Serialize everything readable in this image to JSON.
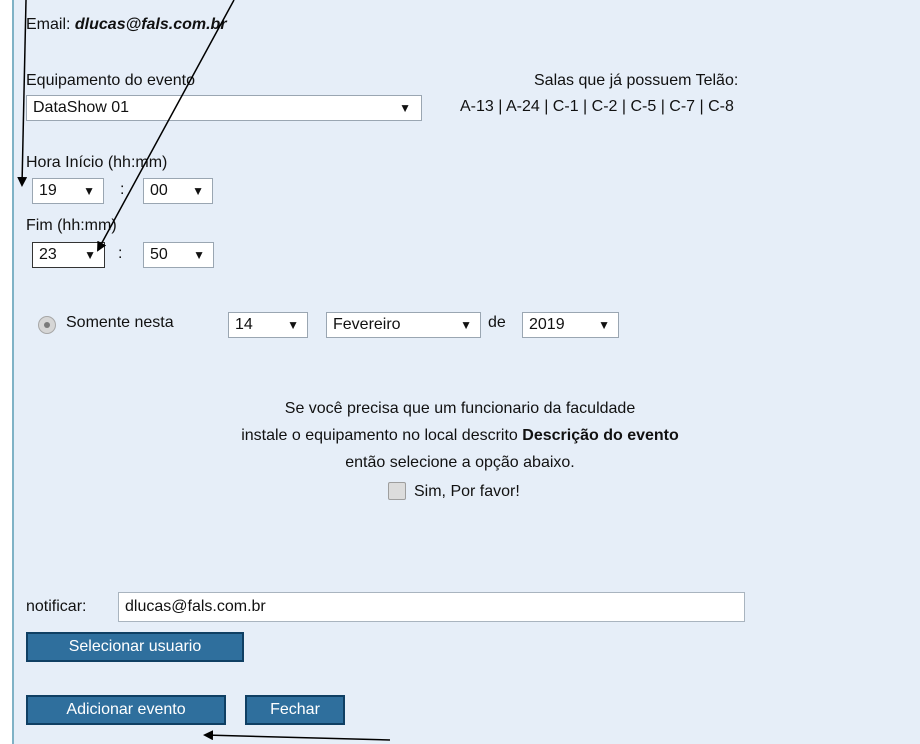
{
  "email": {
    "label": "Email:",
    "value": "dlucas@fals.com.br"
  },
  "equipment": {
    "label": "Equipamento do evento",
    "selected": "DataShow 01"
  },
  "rooms": {
    "title": "Salas que já possuem Telão:",
    "list": "A-13 | A-24 | C-1 | C-2 | C-5 | C-7 | C-8"
  },
  "start": {
    "label": "Hora Início (hh:mm)",
    "hour": "19",
    "minute": "00"
  },
  "end": {
    "label": "Fim (hh:mm)",
    "hour": "23",
    "minute": "50"
  },
  "time_separator": ":",
  "date": {
    "label": "Somente nesta",
    "day": "14",
    "month": "Fevereiro",
    "de": "de",
    "year": "2019"
  },
  "install": {
    "line1": "Se você precisa que um funcionario da faculdade",
    "line2_prefix": "instale o equipamento no local descrito",
    "line2_bold": "Descrição do evento",
    "line3": "então selecione a opção abaixo.",
    "checkbox_label": "Sim, Por favor!"
  },
  "notify": {
    "label": "notificar:",
    "value": "dlucas@fals.com.br"
  },
  "buttons": {
    "select_user": "Selecionar usuario",
    "add_event": "Adicionar evento",
    "close": "Fechar"
  },
  "icons": {
    "dropdown": "▼"
  },
  "colors": {
    "panel_bg": "#e6eef8",
    "button_bg": "#2f6f9d",
    "border_accent": "#7fb2c6"
  }
}
